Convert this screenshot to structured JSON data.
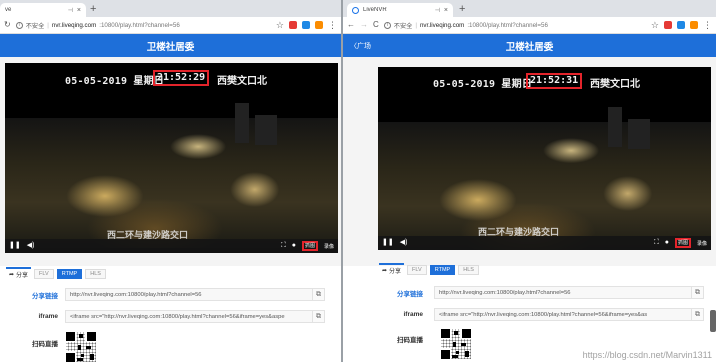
{
  "left": {
    "tab": {
      "title": "ve",
      "pin": "⊣",
      "close": "×"
    },
    "newtab": "+",
    "address": {
      "insecure": "不安全",
      "host": "nvr.liveqing.com",
      "path": ":10800/play.html?channel=56"
    },
    "header": {
      "title": "卫楼社居委",
      "back": ""
    },
    "osd": {
      "date": "05-05-2019 星期日",
      "time": "21:52:29",
      "place": "西樊文口北",
      "bottom": "西二环与建沙路交口"
    },
    "controls": {
      "pause": "❚❚",
      "volume": "◀)",
      "fullscreen": "⛶",
      "snap_icon": "●",
      "snapshot": "抓图",
      "record": "录像"
    },
    "tabs": {
      "share": "分享",
      "protocols": [
        "FLV",
        "RTMP",
        "HLS"
      ],
      "active": "RTMP"
    },
    "rows": {
      "share_label": "分享链接",
      "share_value": "http://nvr.liveqing.com:10800/play.html?channel=56",
      "iframe_label": "iframe",
      "iframe_value": "<iframe src=\"http://nvr.liveqing.com:10800/play.html?channel=56&iframe=yes&aspe",
      "scan_label": "扫码直播"
    }
  },
  "right": {
    "tab": {
      "title": "LiveNVR",
      "pin": "⊣",
      "close": "×"
    },
    "newtab": "+",
    "address": {
      "insecure": "不安全",
      "host": "nvr.liveqing.com",
      "path": ":10800/play.html?channel=56"
    },
    "header": {
      "title": "卫楼社居委",
      "back": "〈广场"
    },
    "osd": {
      "date": "05-05-2019 星期日",
      "time": "21:52:31",
      "place": "西樊文口北",
      "bottom": "西二环与建沙路交口"
    },
    "controls": {
      "pause": "❚❚",
      "volume": "◀)",
      "fullscreen": "⛶",
      "snap_icon": "●",
      "snapshot": "抓图",
      "record": "录像"
    },
    "tabs": {
      "share": "分享",
      "protocols": [
        "FLV",
        "RTMP",
        "HLS"
      ],
      "active": "RTMP"
    },
    "rows": {
      "share_label": "分享链接",
      "share_value": "http://nvr.liveqing.com:10800/play.html?channel=56",
      "iframe_label": "iframe",
      "iframe_value": "<iframe src=\"http://nvr.liveqing.com:10800/play.html?channel=56&iframe=yes&as",
      "scan_label": "扫码直播"
    },
    "watermark": "https://blog.csdn.net/Marvin1311"
  },
  "colors": {
    "header_blue": "#1e6fd9",
    "highlight_red": "#e4242b"
  },
  "icons": {
    "back": "arrow-left-icon",
    "forward": "arrow-right-icon",
    "reload": "reload-icon",
    "star": "star-icon",
    "menu": "menu-icon",
    "copy": "copy-icon",
    "share": "share-icon"
  }
}
